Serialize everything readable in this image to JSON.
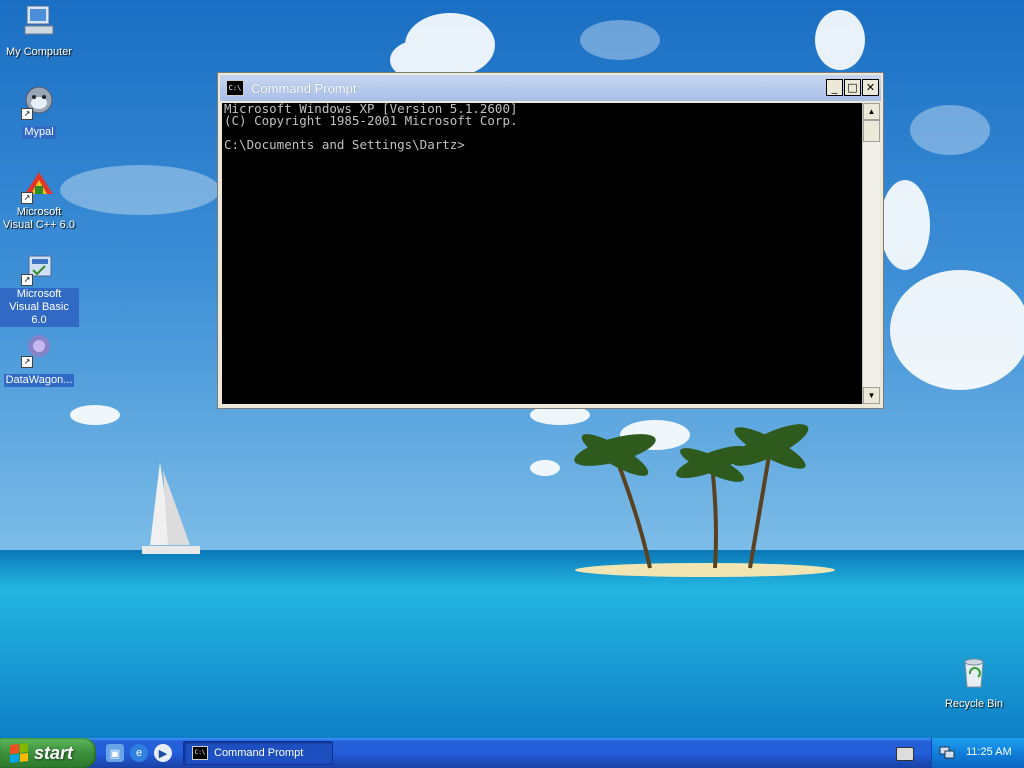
{
  "desktop": {
    "icons": [
      {
        "label": "My Computer"
      },
      {
        "label": "Mypal"
      },
      {
        "label": "Microsoft Visual C++ 6.0"
      },
      {
        "label": "Microsoft Visual Basic 6.0"
      },
      {
        "label": "DataWagon..."
      },
      {
        "label": "Recycle Bin"
      }
    ]
  },
  "window": {
    "title": "Command Prompt",
    "title_icon": "C:\\",
    "controls": {
      "minimize": "_",
      "maximize": "□",
      "close": "✕"
    },
    "console_lines": [
      "Microsoft Windows XP [Version 5.1.2600]",
      "(C) Copyright 1985-2001 Microsoft Corp.",
      "",
      "C:\\Documents and Settings\\Dartz>"
    ]
  },
  "taskbar": {
    "start_label": "start",
    "quick_launch": [
      "show-desktop-icon",
      "internet-explorer-icon",
      "windows-media-player-icon"
    ],
    "tasks": [
      {
        "label": "Command Prompt",
        "icon": "C:\\"
      }
    ],
    "clock": "11:25 AM"
  },
  "colors": {
    "taskbar_blue": "#245edb",
    "start_green": "#3c8f3c",
    "tray_blue": "#0f7fdb",
    "console_bg": "#000000",
    "console_text": "#c0c0c0"
  }
}
